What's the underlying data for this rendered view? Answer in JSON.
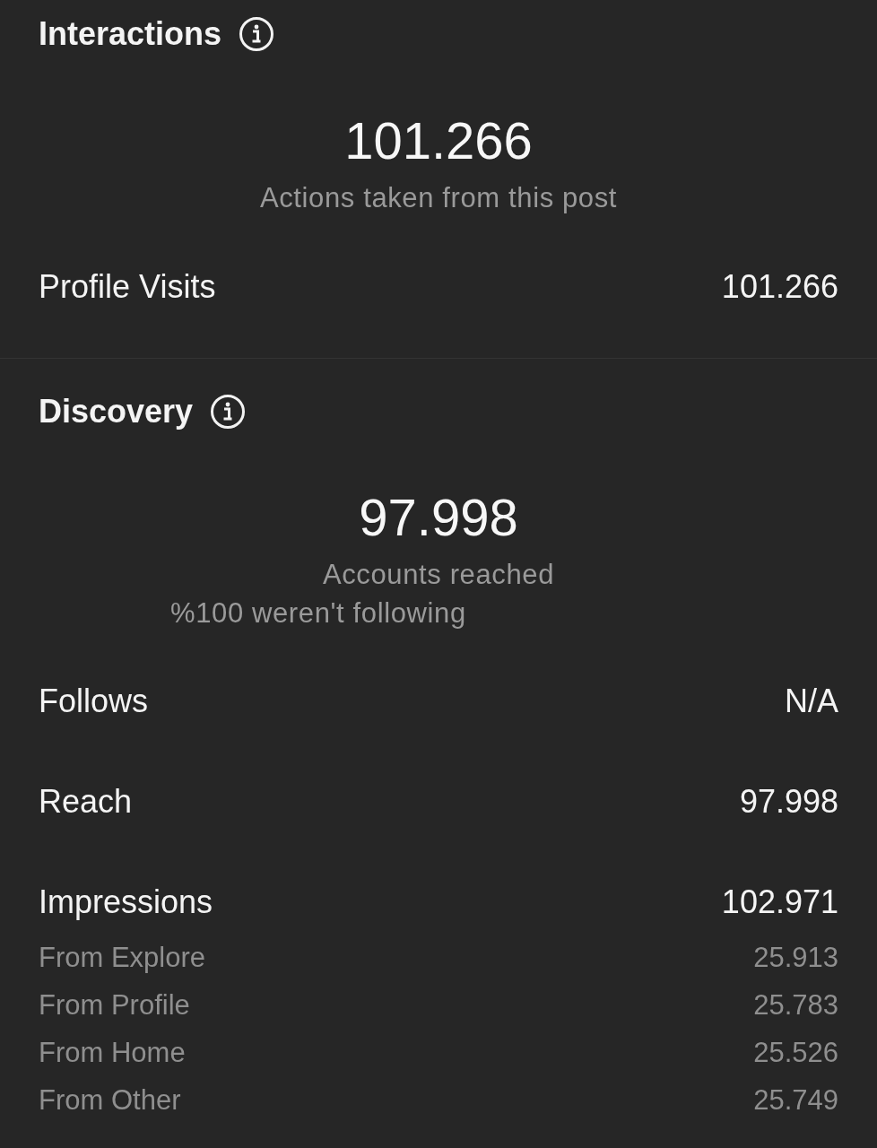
{
  "sections": [
    {
      "title": "Interactions",
      "summary": {
        "value": "101.266",
        "caption": "Actions taken from this post"
      },
      "rows": [
        {
          "label": "Profile Visits",
          "value": "101.266"
        }
      ]
    },
    {
      "title": "Discovery",
      "summary": {
        "value": "97.998",
        "caption": "Accounts reached",
        "note": "%100 weren't following"
      },
      "rows": [
        {
          "label": "Follows",
          "value": "N/A"
        },
        {
          "label": "Reach",
          "value": "97.998"
        },
        {
          "label": "Impressions",
          "value": "102.971",
          "breakdown": [
            {
              "label": "From Explore",
              "value": "25.913"
            },
            {
              "label": "From Profile",
              "value": "25.783"
            },
            {
              "label": "From Home",
              "value": "25.526"
            },
            {
              "label": "From Other",
              "value": "25.749"
            }
          ]
        }
      ]
    }
  ]
}
